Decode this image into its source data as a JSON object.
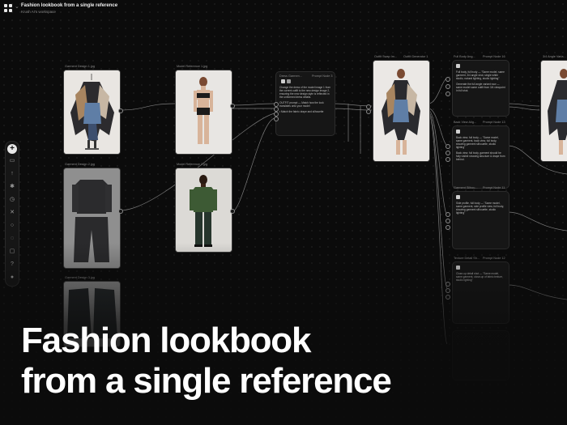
{
  "app": {
    "title": "Fashion lookbook  from a single reference",
    "subtitle": "Krush AI's workspace"
  },
  "toolbar": {
    "icons": [
      "plus-icon",
      "folder-icon",
      "upload-icon",
      "asset-icon",
      "history-icon",
      "close-icon",
      "search-icon",
      "comment-icon",
      "chat-icon",
      "help-icon",
      "avatar-icon"
    ]
  },
  "nodes": {
    "garment1_label": "Garment Design 1.jpg",
    "model1_label": "Model Reference 1.jpg",
    "garment2_label": "Garment Design 2.jpg",
    "model2_label": "Model Reference 2.jpg",
    "garment3_label": "Garment Design 3.jpg",
    "prompt_head": "Dress Garmen...",
    "prompt_tag": "Prompt Node 3",
    "prompt_body_1": "Change the dress of the model image 1 from the current outfit to the new design image 2, ensuring the new design style is reflected in the uniformed dress details.",
    "prompt_body_2": "OUTFIT prompt — Match how the look translates onto your model",
    "prompt_body_3": "• Match the fabric drape and silhouette",
    "output_head": "Outfit Swap Im...",
    "output_tag": "Outfit Generator 1",
    "angle_head": "Full Body Ang...",
    "angle_tag": "Prompt Node 16",
    "angle_body_1": "Full body, full body — \"Same model, same garment, 3/4 angle shot, single white studio, natural lighting, studio lighting\"",
    "angle_body_2": "Generate the full angle variant now — same model same outfit from 3/4 viewpoint in full shot.",
    "angle2_head": "Back View Alig...",
    "angle2_tag": "Prompt Node 13",
    "angle2_body_1": "Back view, full body — \"Same model, same garment, back view, full body, showing garment silhouette, studio lighting\"",
    "angle2_body_2": "Back view, full body, garment should be fully visible showing structure & drape from behind.",
    "angle3_head": "Garment Silhou...",
    "angle3_tag": "Prompt Node 11",
    "angle3_body_1": "Side profile, full body — \"Same model, same garment, side profile view, full body, showing garment silhouette, studio lighting\"",
    "angle4_head": "Texture Detail Sh...",
    "angle4_tag": "Prompt Node 12",
    "angle4_body_1": "Close-up detail shot — \"Same model, same garment, close-up of fabric texture, studio lighting\"",
    "right_head": "3/4 Angle Varia...",
    "right_tag": "Outfit Generator 2"
  },
  "overlay": {
    "line1": "Fashion lookbook",
    "line2": "from a single reference"
  },
  "colors": {
    "background": "#0b0b0b",
    "node": "#161616",
    "wire": "#8f8f8f",
    "overlay_text": "#ffffff"
  }
}
